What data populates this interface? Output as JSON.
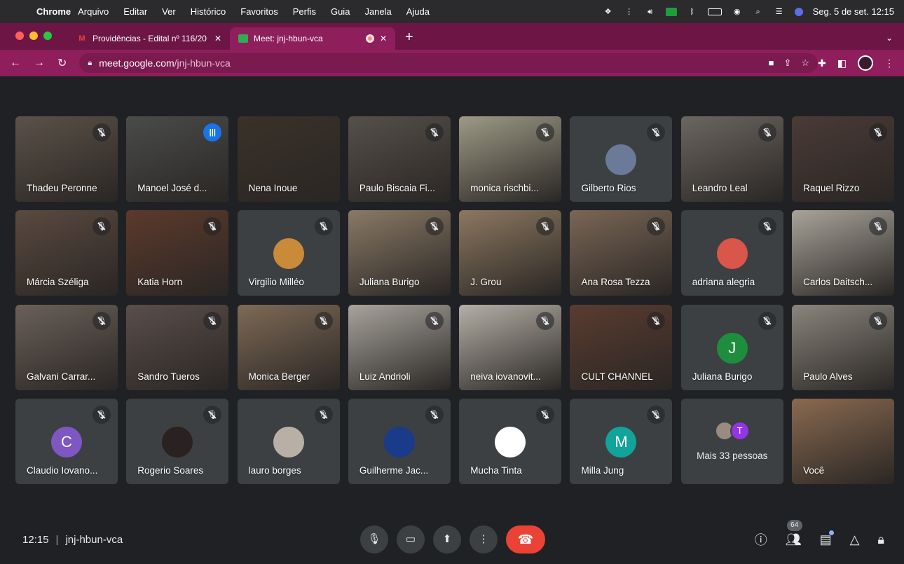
{
  "menubar": {
    "app": "Chrome",
    "items": [
      "Arquivo",
      "Editar",
      "Ver",
      "Histórico",
      "Favoritos",
      "Perfis",
      "Guia",
      "Janela",
      "Ajuda"
    ],
    "clock": "Seg. 5 de set.  12:15"
  },
  "tabs": [
    {
      "title": "Providências - Edital nº 116/20",
      "icon": "gmail-icon"
    },
    {
      "title": "Meet: jnj-hbun-vca",
      "icon": "meet-icon"
    }
  ],
  "address": {
    "host": "meet.google.com",
    "path": "/jnj-hbun-vca"
  },
  "participants": [
    {
      "name": "Thadeu Peronne",
      "type": "video",
      "bg": "#5b5248",
      "muted": true
    },
    {
      "name": "Manoel José d...",
      "type": "video",
      "bg": "#4a4c4a",
      "speaking": true
    },
    {
      "name": "Nena Inoue",
      "type": "video",
      "bg": "#3a3229",
      "muted": false
    },
    {
      "name": "Paulo Biscaia Fi...",
      "type": "video",
      "bg": "#56504a",
      "muted": true
    },
    {
      "name": "monica rischbi...",
      "type": "video",
      "bg": "#9e9a86",
      "muted": true
    },
    {
      "name": "Gilberto Rios",
      "type": "avatar",
      "bg": "#3c4043",
      "avatarColor": "#6b7a99",
      "muted": true
    },
    {
      "name": "Leandro Leal",
      "type": "video",
      "bg": "#6b6660",
      "muted": true
    },
    {
      "name": "Raquel Rizzo",
      "type": "video",
      "bg": "#4a3b36",
      "muted": true
    },
    {
      "name": "Márcia Széliga",
      "type": "video",
      "bg": "#5a4a40",
      "muted": true
    },
    {
      "name": "Katia Horn",
      "type": "video",
      "bg": "#5c3a2c",
      "muted": true
    },
    {
      "name": "Virgilio Milléo",
      "type": "avatar",
      "bg": "#3c4043",
      "avatarColor": "#c98a3a",
      "muted": true
    },
    {
      "name": "Juliana Burigo",
      "type": "video",
      "bg": "#8a7a66",
      "muted": true
    },
    {
      "name": "J. Grou",
      "type": "video",
      "bg": "#8c7860",
      "muted": true
    },
    {
      "name": "Ana Rosa Tezza",
      "type": "video",
      "bg": "#7a6656",
      "muted": true
    },
    {
      "name": "adriana alegria",
      "type": "avatar",
      "bg": "#3c4043",
      "avatarColor": "#d8564a",
      "muted": true
    },
    {
      "name": "Carlos Daitsch...",
      "type": "video",
      "bg": "#a9a49a",
      "muted": true
    },
    {
      "name": "Galvani Carrar...",
      "type": "video",
      "bg": "#6a6058",
      "muted": true
    },
    {
      "name": "Sandro Tueros",
      "type": "video",
      "bg": "#5a4e4a",
      "muted": true
    },
    {
      "name": "Monica Berger",
      "type": "video",
      "bg": "#7e6a56",
      "muted": true
    },
    {
      "name": "Luiz Andrioli",
      "type": "video",
      "bg": "#a8a49c",
      "muted": true
    },
    {
      "name": "neiva iovanovit...",
      "type": "video",
      "bg": "#b5b0a6",
      "muted": true
    },
    {
      "name": "CULT CHANNEL",
      "type": "video",
      "bg": "#5a3c30",
      "muted": true
    },
    {
      "name": "Juliana Burigo",
      "type": "letter",
      "letter": "J",
      "avatarColor": "#1e8e3e",
      "muted": true
    },
    {
      "name": "Paulo Alves",
      "type": "video",
      "bg": "#8a857c",
      "muted": true
    },
    {
      "name": "Claudio Iovano...",
      "type": "letter",
      "letter": "C",
      "avatarColor": "#7e57c2",
      "muted": true
    },
    {
      "name": "Rogerio Soares",
      "type": "avatar",
      "bg": "#3c4043",
      "avatarColor": "#2a2220",
      "muted": true
    },
    {
      "name": "lauro borges",
      "type": "avatar",
      "bg": "#3c4043",
      "avatarColor": "#b8b0a4",
      "muted": true
    },
    {
      "name": "Guilherme Jac...",
      "type": "avatar",
      "bg": "#3c4043",
      "avatarColor": "#1a3a8a",
      "muted": true
    },
    {
      "name": "Mucha Tinta",
      "type": "avatar",
      "bg": "#3c4043",
      "avatarColor": "#ffffff",
      "muted": true
    },
    {
      "name": "Milla Jung",
      "type": "letter",
      "letter": "M",
      "avatarColor": "#12a39a",
      "muted": true
    },
    {
      "name": "Mais 33 pessoas",
      "type": "more",
      "letter": "T"
    },
    {
      "name": "Você",
      "type": "video",
      "bg": "#8a6a50",
      "muted": false
    }
  ],
  "bottom": {
    "time": "12:15",
    "meeting_code": "jnj-hbun-vca",
    "people_count": "64"
  }
}
